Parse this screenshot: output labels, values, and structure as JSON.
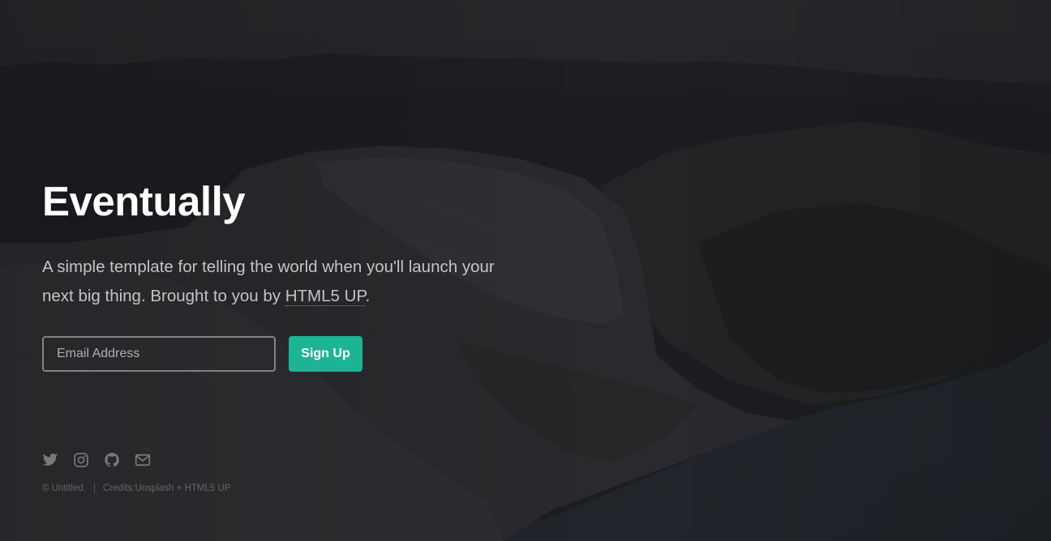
{
  "hero": {
    "title": "Eventually",
    "subtitle_text": "A simple template for telling the world when you'll launch your next big thing. Brought to you by ",
    "subtitle_link": "HTML5 UP",
    "subtitle_end": "."
  },
  "signup": {
    "email_placeholder": "Email Address",
    "button_label": "Sign Up"
  },
  "social": [
    "twitter-icon",
    "instagram-icon",
    "github-icon",
    "envelope-icon"
  ],
  "footer": {
    "copyright": "© Untitled.",
    "credits_prefix": "Credits: ",
    "credits_unsplash": "Unsplash",
    "credits_plus": " + ",
    "credits_html5up": "HTML5 UP"
  },
  "colors": {
    "accent": "#1cb495",
    "background": "#1d1f23"
  }
}
